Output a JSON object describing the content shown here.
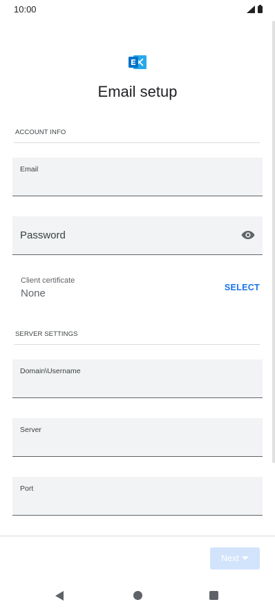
{
  "status_bar": {
    "time": "10:00"
  },
  "header": {
    "app_icon": "exchange-icon",
    "title": "Email setup"
  },
  "account_info": {
    "section_title": "ACCOUNT INFO",
    "email_label": "Email",
    "email_value": "",
    "password_label": "Password",
    "password_value": "",
    "visibility_icon": "eye-icon",
    "client_certificate_label": "Client certificate",
    "client_certificate_value": "None",
    "select_label": "SELECT"
  },
  "server_settings": {
    "section_title": "SERVER SETTINGS",
    "domain_username_label": "Domain\\Username",
    "server_label": "Server",
    "port_label": "Port"
  },
  "footer": {
    "next_label": "Next",
    "next_icon": "caret-down-icon"
  },
  "nav_bar": {
    "back_icon": "back-triangle-icon",
    "home_icon": "home-circle-icon",
    "recents_icon": "recents-square-icon"
  },
  "colors": {
    "accent": "#1a73e8",
    "field_background": "#f1f3f4",
    "disabled_button": "#d2e3fc",
    "exchange_brand": "#0072c6"
  }
}
